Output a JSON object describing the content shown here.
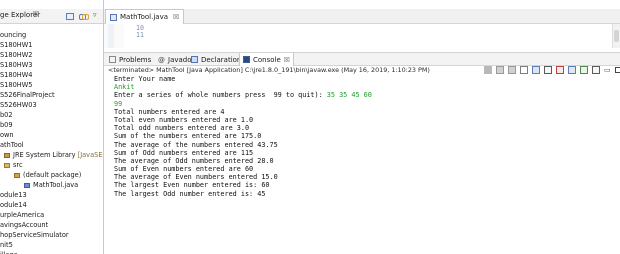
{
  "package_explorer": {
    "tab_title": "ge Explorer",
    "tab_close": "☒",
    "view_menu": "▿",
    "items": [
      {
        "label": "ouncing"
      },
      {
        "label": "S180HW1"
      },
      {
        "label": "S180HW2"
      },
      {
        "label": "S180HW3"
      },
      {
        "label": "S180HW4"
      },
      {
        "label": "S180HW5"
      },
      {
        "label": "S526FinalProject"
      },
      {
        "label": "S526HW03"
      },
      {
        "label": "b02"
      },
      {
        "label": "b09"
      },
      {
        "label": "own"
      },
      {
        "label": "athTool"
      },
      {
        "label": "JRE System Library",
        "suffix": " [JavaSE-1.8]"
      },
      {
        "label": "src"
      },
      {
        "label": "(default package)"
      },
      {
        "label": "MathTool.java"
      },
      {
        "label": "odule13"
      },
      {
        "label": "odule14"
      },
      {
        "label": "urpleAmerica"
      },
      {
        "label": "avingsAccount"
      },
      {
        "label": "hopServiceSimulator"
      },
      {
        "label": "nit5"
      },
      {
        "label": "illage"
      }
    ]
  },
  "editor": {
    "tab_label": "MathTool.java",
    "tab_close": "☒",
    "line_numbers": [
      "10",
      "11"
    ]
  },
  "panel_tabs": {
    "problems": "Problems",
    "javadoc": "Javadoc",
    "declaration": "Declaration",
    "console": "Console",
    "console_close": "☒",
    "javadoc_icon": "@"
  },
  "console": {
    "terminated": "<terminated> MathTool [Java Application] C:\\jre1.8.0_191\\bin\\javaw.exe (May 16, 2019, 1:10:23 PM)",
    "minimize": "▭",
    "lines": [
      {
        "text": "Enter Your name",
        "input": false
      },
      {
        "text": "Ankit",
        "input": true
      },
      {
        "text": "Enter a series of whole numbers press  99 to quit): ",
        "input_part": "35 35 45 60"
      },
      {
        "text": "99",
        "input": true
      },
      {
        "text": "Total numbers entered are 4",
        "input": false
      },
      {
        "text": "Total even numbers entered are 1.0",
        "input": false
      },
      {
        "text": "Total odd numbers entered are 3.0",
        "input": false
      },
      {
        "text": "Sum of the numbers entered are 175.0",
        "input": false
      },
      {
        "text": "The average of the numbers entered 43.75",
        "input": false
      },
      {
        "text": "Sum of Odd numbers entered are 115",
        "input": false
      },
      {
        "text": "The average of Odd numbers entered 28.0",
        "input": false
      },
      {
        "text": "Sum of Even numbers entered are 60",
        "input": false
      },
      {
        "text": "The average of Even numbers entered 15.0",
        "input": false
      },
      {
        "text": "The largest Even number entered is: 60",
        "input": false
      },
      {
        "text": "The largest Odd number entered is: 45",
        "input": false
      }
    ]
  }
}
